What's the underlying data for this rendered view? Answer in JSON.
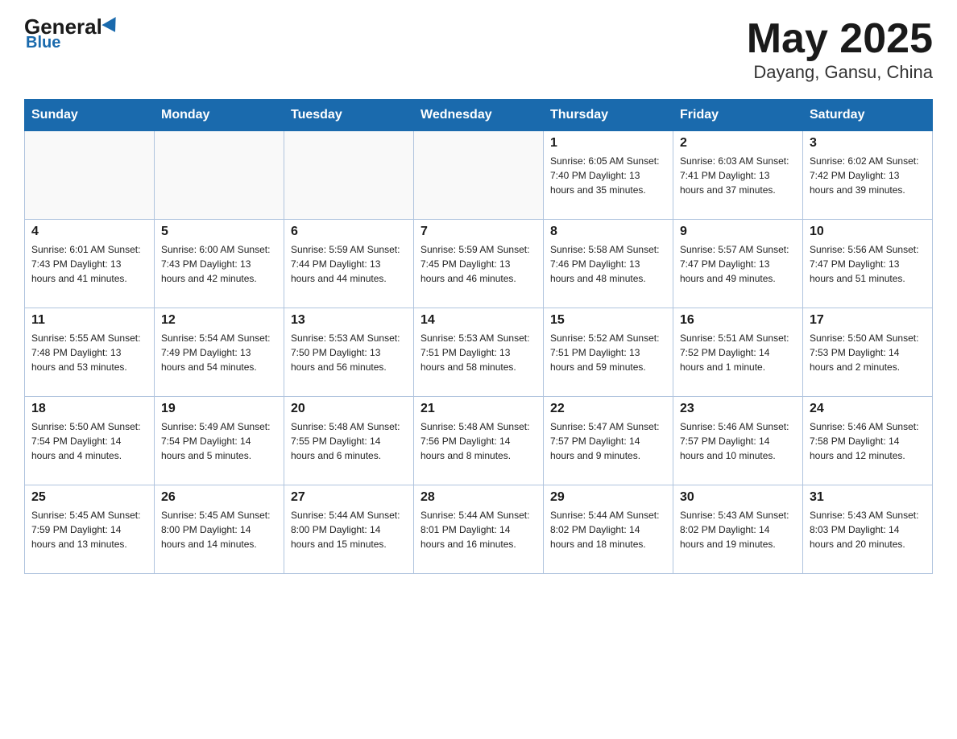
{
  "header": {
    "logo_general": "General",
    "logo_blue": "Blue",
    "month_title": "May 2025",
    "location": "Dayang, Gansu, China"
  },
  "days_of_week": [
    "Sunday",
    "Monday",
    "Tuesday",
    "Wednesday",
    "Thursday",
    "Friday",
    "Saturday"
  ],
  "weeks": [
    {
      "days": [
        {
          "num": "",
          "info": ""
        },
        {
          "num": "",
          "info": ""
        },
        {
          "num": "",
          "info": ""
        },
        {
          "num": "",
          "info": ""
        },
        {
          "num": "1",
          "info": "Sunrise: 6:05 AM\nSunset: 7:40 PM\nDaylight: 13 hours\nand 35 minutes."
        },
        {
          "num": "2",
          "info": "Sunrise: 6:03 AM\nSunset: 7:41 PM\nDaylight: 13 hours\nand 37 minutes."
        },
        {
          "num": "3",
          "info": "Sunrise: 6:02 AM\nSunset: 7:42 PM\nDaylight: 13 hours\nand 39 minutes."
        }
      ]
    },
    {
      "days": [
        {
          "num": "4",
          "info": "Sunrise: 6:01 AM\nSunset: 7:43 PM\nDaylight: 13 hours\nand 41 minutes."
        },
        {
          "num": "5",
          "info": "Sunrise: 6:00 AM\nSunset: 7:43 PM\nDaylight: 13 hours\nand 42 minutes."
        },
        {
          "num": "6",
          "info": "Sunrise: 5:59 AM\nSunset: 7:44 PM\nDaylight: 13 hours\nand 44 minutes."
        },
        {
          "num": "7",
          "info": "Sunrise: 5:59 AM\nSunset: 7:45 PM\nDaylight: 13 hours\nand 46 minutes."
        },
        {
          "num": "8",
          "info": "Sunrise: 5:58 AM\nSunset: 7:46 PM\nDaylight: 13 hours\nand 48 minutes."
        },
        {
          "num": "9",
          "info": "Sunrise: 5:57 AM\nSunset: 7:47 PM\nDaylight: 13 hours\nand 49 minutes."
        },
        {
          "num": "10",
          "info": "Sunrise: 5:56 AM\nSunset: 7:47 PM\nDaylight: 13 hours\nand 51 minutes."
        }
      ]
    },
    {
      "days": [
        {
          "num": "11",
          "info": "Sunrise: 5:55 AM\nSunset: 7:48 PM\nDaylight: 13 hours\nand 53 minutes."
        },
        {
          "num": "12",
          "info": "Sunrise: 5:54 AM\nSunset: 7:49 PM\nDaylight: 13 hours\nand 54 minutes."
        },
        {
          "num": "13",
          "info": "Sunrise: 5:53 AM\nSunset: 7:50 PM\nDaylight: 13 hours\nand 56 minutes."
        },
        {
          "num": "14",
          "info": "Sunrise: 5:53 AM\nSunset: 7:51 PM\nDaylight: 13 hours\nand 58 minutes."
        },
        {
          "num": "15",
          "info": "Sunrise: 5:52 AM\nSunset: 7:51 PM\nDaylight: 13 hours\nand 59 minutes."
        },
        {
          "num": "16",
          "info": "Sunrise: 5:51 AM\nSunset: 7:52 PM\nDaylight: 14 hours\nand 1 minute."
        },
        {
          "num": "17",
          "info": "Sunrise: 5:50 AM\nSunset: 7:53 PM\nDaylight: 14 hours\nand 2 minutes."
        }
      ]
    },
    {
      "days": [
        {
          "num": "18",
          "info": "Sunrise: 5:50 AM\nSunset: 7:54 PM\nDaylight: 14 hours\nand 4 minutes."
        },
        {
          "num": "19",
          "info": "Sunrise: 5:49 AM\nSunset: 7:54 PM\nDaylight: 14 hours\nand 5 minutes."
        },
        {
          "num": "20",
          "info": "Sunrise: 5:48 AM\nSunset: 7:55 PM\nDaylight: 14 hours\nand 6 minutes."
        },
        {
          "num": "21",
          "info": "Sunrise: 5:48 AM\nSunset: 7:56 PM\nDaylight: 14 hours\nand 8 minutes."
        },
        {
          "num": "22",
          "info": "Sunrise: 5:47 AM\nSunset: 7:57 PM\nDaylight: 14 hours\nand 9 minutes."
        },
        {
          "num": "23",
          "info": "Sunrise: 5:46 AM\nSunset: 7:57 PM\nDaylight: 14 hours\nand 10 minutes."
        },
        {
          "num": "24",
          "info": "Sunrise: 5:46 AM\nSunset: 7:58 PM\nDaylight: 14 hours\nand 12 minutes."
        }
      ]
    },
    {
      "days": [
        {
          "num": "25",
          "info": "Sunrise: 5:45 AM\nSunset: 7:59 PM\nDaylight: 14 hours\nand 13 minutes."
        },
        {
          "num": "26",
          "info": "Sunrise: 5:45 AM\nSunset: 8:00 PM\nDaylight: 14 hours\nand 14 minutes."
        },
        {
          "num": "27",
          "info": "Sunrise: 5:44 AM\nSunset: 8:00 PM\nDaylight: 14 hours\nand 15 minutes."
        },
        {
          "num": "28",
          "info": "Sunrise: 5:44 AM\nSunset: 8:01 PM\nDaylight: 14 hours\nand 16 minutes."
        },
        {
          "num": "29",
          "info": "Sunrise: 5:44 AM\nSunset: 8:02 PM\nDaylight: 14 hours\nand 18 minutes."
        },
        {
          "num": "30",
          "info": "Sunrise: 5:43 AM\nSunset: 8:02 PM\nDaylight: 14 hours\nand 19 minutes."
        },
        {
          "num": "31",
          "info": "Sunrise: 5:43 AM\nSunset: 8:03 PM\nDaylight: 14 hours\nand 20 minutes."
        }
      ]
    }
  ]
}
